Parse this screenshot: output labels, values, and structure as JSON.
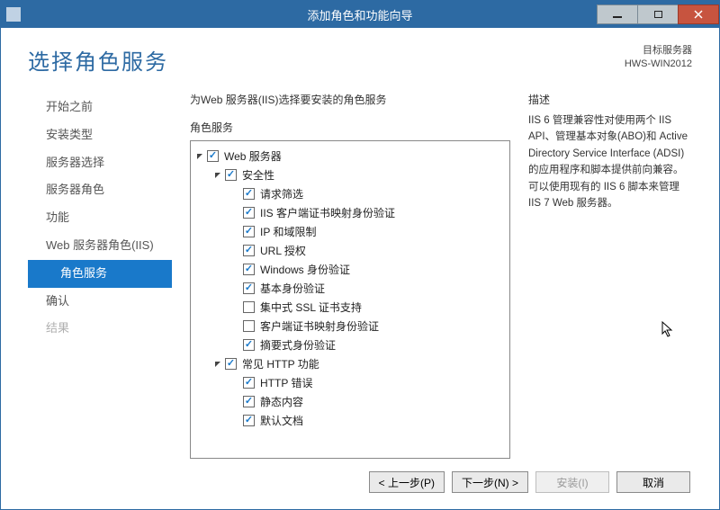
{
  "window": {
    "title": "添加角色和功能向导"
  },
  "header": {
    "page_title": "选择角色服务",
    "target_label": "目标服务器",
    "target_value": "HWS-WIN2012"
  },
  "nav": {
    "items": [
      {
        "label": "开始之前",
        "selected": false,
        "sub": false,
        "disabled": false
      },
      {
        "label": "安装类型",
        "selected": false,
        "sub": false,
        "disabled": false
      },
      {
        "label": "服务器选择",
        "selected": false,
        "sub": false,
        "disabled": false
      },
      {
        "label": "服务器角色",
        "selected": false,
        "sub": false,
        "disabled": false
      },
      {
        "label": "功能",
        "selected": false,
        "sub": false,
        "disabled": false
      },
      {
        "label": "Web 服务器角色(IIS)",
        "selected": false,
        "sub": false,
        "disabled": false
      },
      {
        "label": "角色服务",
        "selected": true,
        "sub": true,
        "disabled": false
      },
      {
        "label": "确认",
        "selected": false,
        "sub": false,
        "disabled": false
      },
      {
        "label": "结果",
        "selected": false,
        "sub": false,
        "disabled": true
      }
    ]
  },
  "center": {
    "instruction": "为Web 服务器(IIS)选择要安装的角色服务",
    "section_label": "角色服务",
    "tree": [
      {
        "indent": 0,
        "arrow": "open",
        "checked": true,
        "label": "Web 服务器"
      },
      {
        "indent": 1,
        "arrow": "open",
        "checked": true,
        "label": "安全性"
      },
      {
        "indent": 2,
        "arrow": "none",
        "checked": true,
        "label": "请求筛选"
      },
      {
        "indent": 2,
        "arrow": "none",
        "checked": true,
        "label": "IIS 客户端证书映射身份验证"
      },
      {
        "indent": 2,
        "arrow": "none",
        "checked": true,
        "label": "IP 和域限制"
      },
      {
        "indent": 2,
        "arrow": "none",
        "checked": true,
        "label": "URL 授权"
      },
      {
        "indent": 2,
        "arrow": "none",
        "checked": true,
        "label": "Windows 身份验证"
      },
      {
        "indent": 2,
        "arrow": "none",
        "checked": true,
        "label": "基本身份验证"
      },
      {
        "indent": 2,
        "arrow": "none",
        "checked": false,
        "label": "集中式 SSL 证书支持"
      },
      {
        "indent": 2,
        "arrow": "none",
        "checked": false,
        "label": "客户端证书映射身份验证"
      },
      {
        "indent": 2,
        "arrow": "none",
        "checked": true,
        "label": "摘要式身份验证"
      },
      {
        "indent": 1,
        "arrow": "open",
        "checked": true,
        "label": "常见 HTTP 功能"
      },
      {
        "indent": 2,
        "arrow": "none",
        "checked": true,
        "label": "HTTP 错误"
      },
      {
        "indent": 2,
        "arrow": "none",
        "checked": true,
        "label": "静态内容"
      },
      {
        "indent": 2,
        "arrow": "none",
        "checked": true,
        "label": "默认文档"
      }
    ]
  },
  "description": {
    "title": "描述",
    "text": "IIS 6 管理兼容性对使用两个 IIS API、管理基本对象(ABO)和 Active Directory Service Interface (ADSI) 的应用程序和脚本提供前向兼容。可以使用现有的 IIS 6 脚本来管理 IIS 7 Web 服务器。"
  },
  "buttons": {
    "prev": "< 上一步(P)",
    "next": "下一步(N) >",
    "install": "安装(I)",
    "cancel": "取消"
  }
}
